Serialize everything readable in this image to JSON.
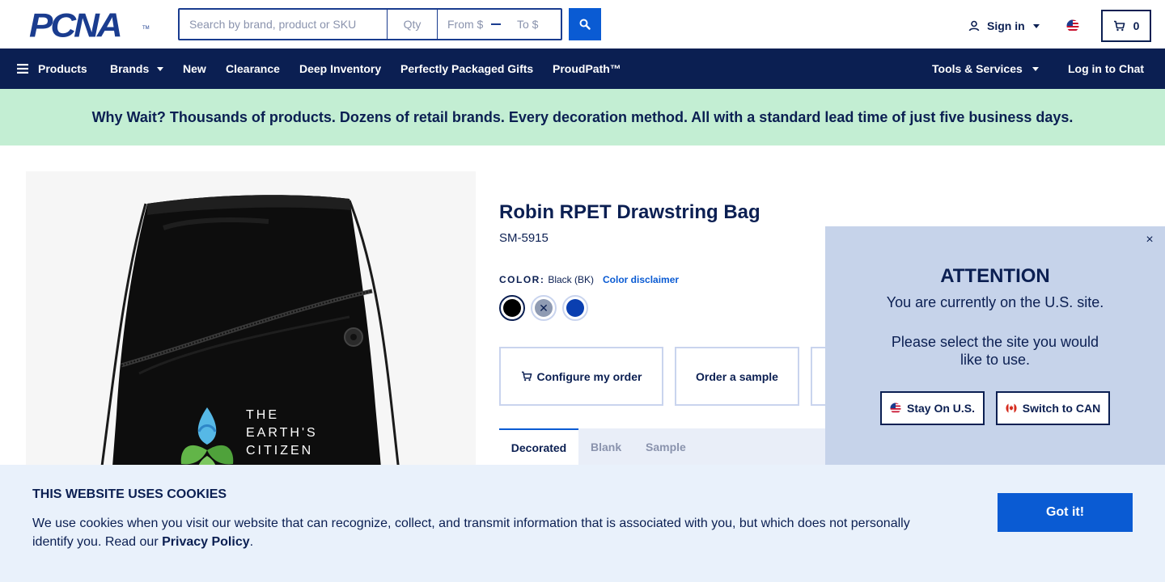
{
  "header": {
    "logo": "PCNA",
    "logo_tm": "TM",
    "search_placeholder": "Search by brand, product or SKU",
    "qty_placeholder": "Qty",
    "price_from_placeholder": "From $",
    "price_to_placeholder": "To $",
    "sign_in": "Sign in",
    "cart_count": "0"
  },
  "nav": {
    "products": "Products",
    "brands": "Brands",
    "new": "New",
    "clearance": "Clearance",
    "deep_inventory": "Deep Inventory",
    "perfectly_packaged": "Perfectly Packaged Gifts",
    "proudpath": "ProudPath™",
    "tools": "Tools & Services",
    "chat": "Log in to Chat"
  },
  "promo": "Why Wait? Thousands of products. Dozens of retail brands. Every decoration method. All with a standard lead time of just five business days.",
  "product": {
    "name": "Robin RPET Drawstring Bag",
    "sku": "SM-5915",
    "color_label": "COLOR:",
    "color_value": "Black (BK)",
    "color_disclaimer": "Color disclaimer",
    "swatches": [
      {
        "name": "Black",
        "color": "#000000"
      },
      {
        "name": "Gray",
        "color": "#8f9bb3"
      },
      {
        "name": "Royal Blue",
        "color": "#0a3fb0"
      }
    ],
    "image_text": [
      "THE",
      "EARTH'S",
      "CITIZEN"
    ]
  },
  "actions": {
    "configure": "Configure my order",
    "sample": "Order a sample"
  },
  "tabs": {
    "decorated": "Decorated",
    "blank": "Blank",
    "sample": "Sample"
  },
  "modal": {
    "close": "×",
    "title": "ATTENTION",
    "line1": "You are currently on the U.S. site.",
    "line2": "Please select the site you would like to use.",
    "stay": "Stay On U.S.",
    "switch": "Switch to CAN"
  },
  "cookie": {
    "title": "THIS WEBSITE USES COOKIES",
    "text": "We use cookies when you visit our website that can recognize, collect, and transmit information that is associated with you, but which does not personally identify you. Read our ",
    "link": "Privacy Policy",
    "period": ".",
    "button": "Got it!"
  },
  "colors": {
    "navy": "#0b1f52",
    "accent": "#0a5bd3",
    "promo_bg": "#c3eed3",
    "modal_bg": "#c6d3ea",
    "cookie_bg": "#e9f1fb"
  }
}
